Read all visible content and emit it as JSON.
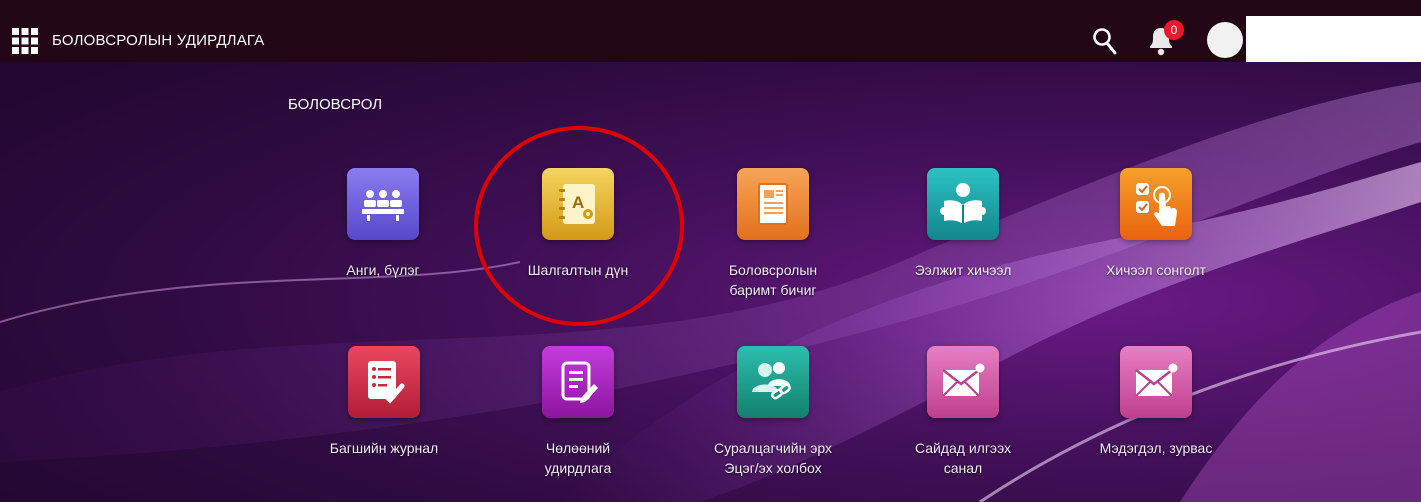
{
  "header": {
    "title": "БОЛОВСРОЛЫН УДИРДЛАГА",
    "notification_count": "0"
  },
  "section": {
    "title": "БОЛОВСРОЛ"
  },
  "tiles": [
    {
      "line1": "Анги, бүлэг",
      "line2": "",
      "icon": "classroom-icon",
      "color": "#6a5bd8"
    },
    {
      "line1": "Шалгалтын дүн",
      "line2": "",
      "icon": "exam-results-icon",
      "color": "#e2b528"
    },
    {
      "line1": "Боловсролын",
      "line2": "баримт бичиг",
      "icon": "document-icon",
      "color": "#ef8a2e"
    },
    {
      "line1": "Ээлжит хичээл",
      "line2": "",
      "icon": "reading-student-icon",
      "color": "#1f9fa5"
    },
    {
      "line1": "Хичээл сонголт",
      "line2": "",
      "icon": "selection-touch-icon",
      "color": "#f07d1e"
    },
    {
      "line1": "Багшийн журнал",
      "line2": "",
      "icon": "teacher-journal-icon",
      "color": "#c9283e"
    },
    {
      "line1": "Чөлөөний",
      "line2": "удирдлага",
      "icon": "leave-request-icon",
      "color": "#a321b8"
    },
    {
      "line1": "Суралцагчийн эрх",
      "line2": "Эцэг/эх холбох",
      "icon": "link-users-icon",
      "color": "#1e9e8f"
    },
    {
      "line1": "Сайдад илгээх",
      "line2": "санал",
      "icon": "mail-icon",
      "color": "#d45ba6"
    },
    {
      "line1": "Мэдэгдэл, зурвас",
      "line2": "",
      "icon": "mail-icon",
      "color": "#d45ba6"
    }
  ]
}
